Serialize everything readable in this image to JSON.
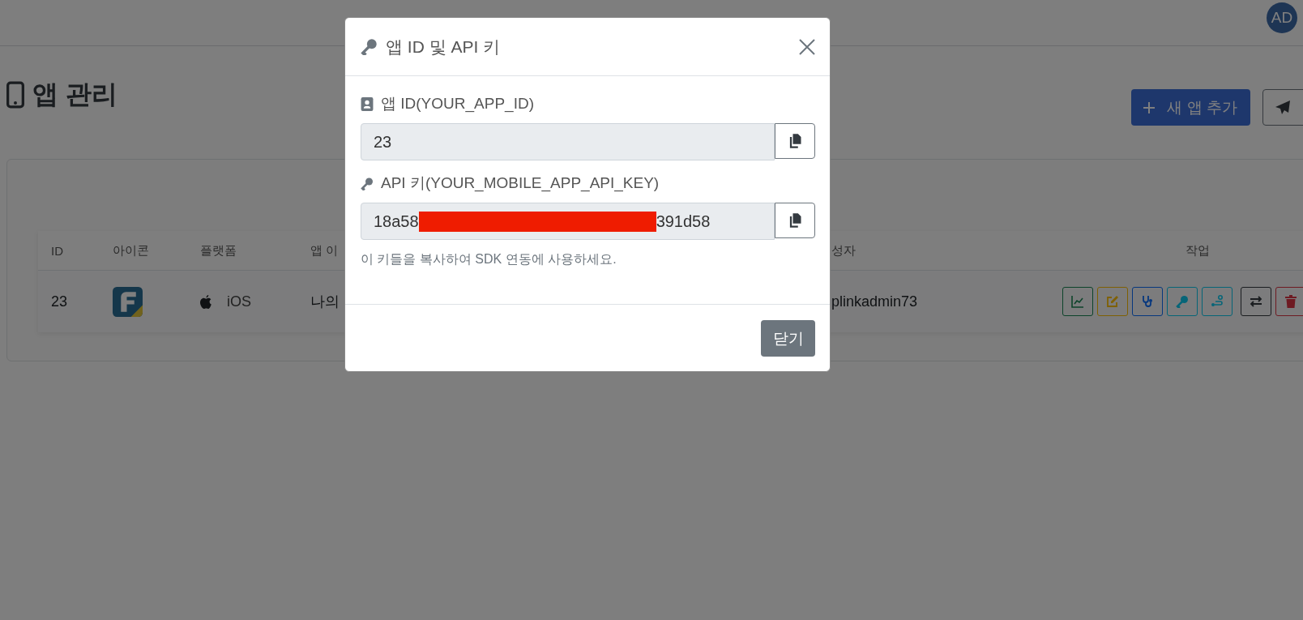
{
  "topbar": {
    "avatar": "AD"
  },
  "page": {
    "title": "앱 관리",
    "buttons": [
      {
        "label": "새 앱 추가",
        "kind": "primary"
      },
      {
        "kind": "send"
      }
    ]
  },
  "table": {
    "columns": [
      "ID",
      "아이콘",
      "플랫폼",
      "앱 이",
      "성자",
      "작업"
    ],
    "rows": [
      {
        "id": "23",
        "platform": "iOS",
        "name": "나의",
        "author": "plinkadmin73",
        "actions": [
          {
            "kind": "stats"
          },
          {
            "kind": "edit"
          },
          {
            "kind": "diagnose"
          },
          {
            "kind": "keys"
          },
          {
            "kind": "flow"
          },
          {
            "kind": "transfer"
          },
          {
            "kind": "delete"
          }
        ]
      }
    ]
  },
  "modal": {
    "title": "앱 ID 및 API 키",
    "fields": [
      {
        "kind": "id",
        "label": "앱 ID(YOUR_APP_ID)",
        "value": "23"
      },
      {
        "kind": "key",
        "label": "API 키(YOUR_MOBILE_APP_API_KEY)",
        "value": "18a58",
        "value_end": "391d58",
        "redacted": true
      }
    ],
    "help": "이 키들을 복사하여 SDK 연동에 사용하세요.",
    "close_button": "닫기"
  }
}
